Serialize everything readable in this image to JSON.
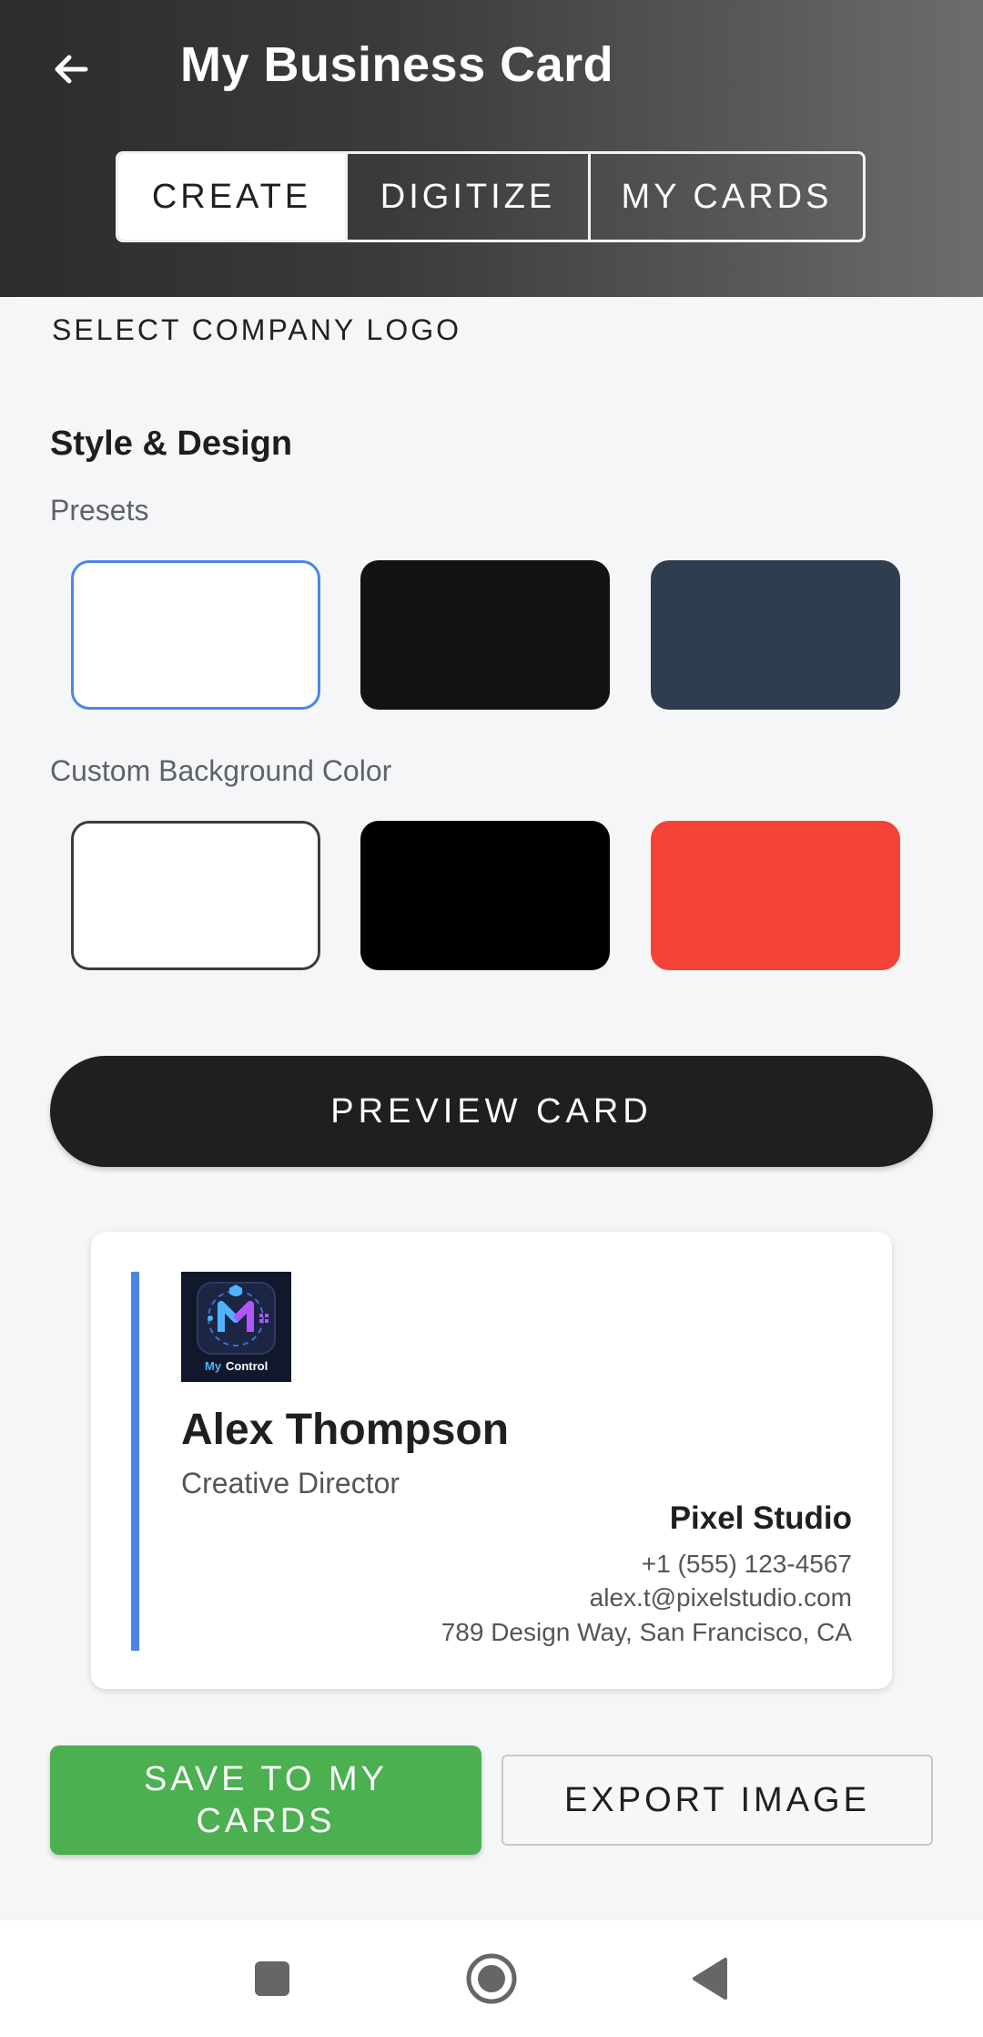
{
  "header": {
    "title": "My Business Card",
    "tabs": [
      {
        "label": "CREATE",
        "selected": true
      },
      {
        "label": "DIGITIZE",
        "selected": false
      },
      {
        "label": "MY CARDS",
        "selected": false
      }
    ]
  },
  "logo_section": {
    "label": "SELECT COMPANY LOGO"
  },
  "style": {
    "title": "Style & Design",
    "presets_label": "Presets",
    "presets": [
      {
        "color": "#ffffff",
        "selected": true
      },
      {
        "color": "#131313",
        "selected": false
      },
      {
        "color": "#2e3d50",
        "selected": false
      }
    ],
    "custom_label": "Custom Background Color",
    "custom_colors": [
      {
        "color": "#ffffff"
      },
      {
        "color": "#000000"
      },
      {
        "color": "#f44336"
      }
    ]
  },
  "preview_button": "PREVIEW CARD",
  "card": {
    "accent_color": "#4a86e8",
    "logo_text_a": "My",
    "logo_text_b": "Control",
    "name": "Alex Thompson",
    "role": "Creative Director",
    "company": "Pixel Studio",
    "phone": "+1 (555) 123-4567",
    "email": "alex.t@pixelstudio.com",
    "address": "789 Design Way, San Francisco, CA"
  },
  "actions": {
    "save_line1": "SAVE TO MY",
    "save_line2": "CARDS",
    "export": "EXPORT IMAGE"
  },
  "icons": [
    "back-arrow-icon",
    "square-nav-icon",
    "home-circle-icon",
    "back-triangle-icon"
  ]
}
